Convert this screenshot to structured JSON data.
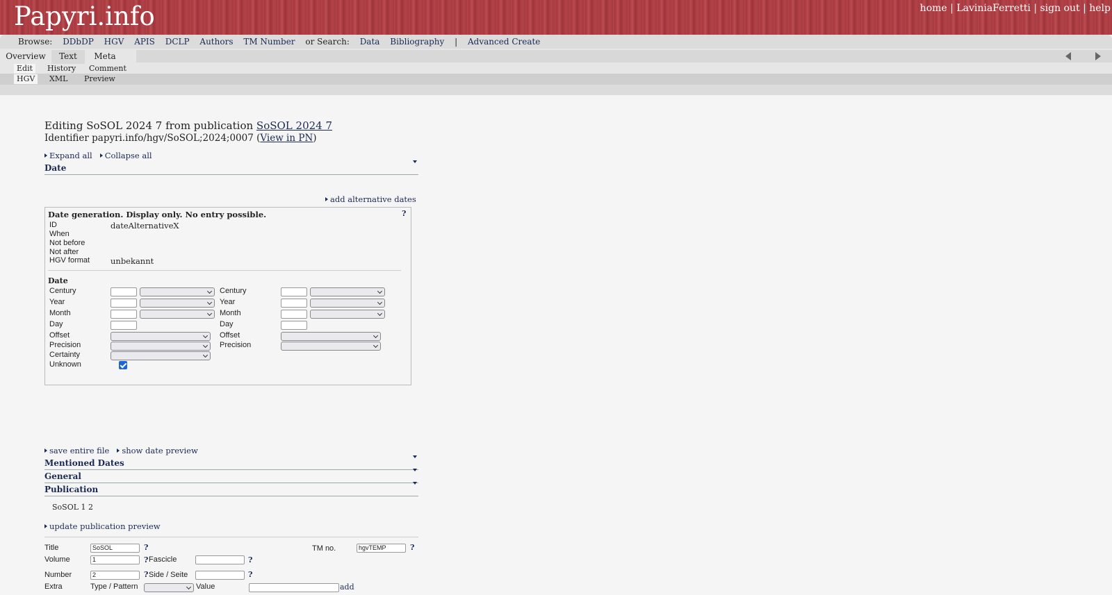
{
  "header": {
    "logo": "Papyri.info",
    "links": {
      "home": "home",
      "sep1": "|",
      "user": "LaviniaFerretti",
      "sep2": "|",
      "signout": "sign out",
      "sep3": "|",
      "help": "help"
    }
  },
  "browse": {
    "label": "Browse:",
    "items": [
      "DDbDP",
      "HGV",
      "APIS",
      "DCLP",
      "Authors",
      "TM Number"
    ],
    "search_label": "or Search:",
    "search_items": [
      "Data",
      "Bibliography"
    ],
    "divider": "|",
    "advanced": "Advanced Create"
  },
  "tabs": {
    "overview": "Overview",
    "text": "Text",
    "meta": "Meta"
  },
  "subtabs1": {
    "edit": "Edit",
    "history": "History",
    "comment": "Comment"
  },
  "subtabs2": {
    "hgv": "HGV",
    "xml": "XML",
    "preview": "Preview"
  },
  "page": {
    "title_prefix": "Editing SoSOL 2024 7 from publication",
    "title_link": "SoSOL 2024 7",
    "identifier_prefix": "Identifier papyri.info/hgv/SoSOL;2024;0007 (",
    "identifier_link": "View in PN",
    "identifier_suffix": ")",
    "expand_all": "Expand all",
    "collapse_all": "Collapse all"
  },
  "sections": {
    "date": "Date",
    "add_alt_dates": "add alternative dates",
    "save_file": "save entire file",
    "show_preview": "show date preview",
    "mentioned_dates": "Mentioned Dates",
    "general": "General",
    "publication": "Publication",
    "pub_preview_text": "SoSOL 1 2",
    "update_pub_preview": "update publication preview"
  },
  "datebox": {
    "title": "Date generation. Display only. No entry possible.",
    "help": "?",
    "fields": {
      "id_label": "ID",
      "id_value": "dateAlternativeX",
      "when_label": "When",
      "not_before_label": "Not before",
      "not_after_label": "Not after",
      "hgv_format_label": "HGV format",
      "hgv_format_value": "unbekannt"
    },
    "date_heading": "Date",
    "left": {
      "century": "Century",
      "year": "Year",
      "month": "Month",
      "day": "Day",
      "offset": "Offset",
      "precision": "Precision",
      "certainty": "Certainty",
      "unknown": "Unknown"
    },
    "right": {
      "century": "Century",
      "year": "Year",
      "month": "Month",
      "day": "Day",
      "offset": "Offset",
      "precision": "Precision"
    },
    "unknown_checked": true
  },
  "publication": {
    "title_label": "Title",
    "title_value": "SoSOL",
    "tm_label": "TM no.",
    "tm_value": "hgvTEMP",
    "volume_label": "Volume",
    "volume_value": "1",
    "fascicle_label": "Fascicle",
    "fascicle_value": "",
    "number_label": "Number",
    "number_value": "2",
    "side_label": "Side / Seite",
    "side_value": "",
    "extra_label": "Extra",
    "type_label": "Type / Pattern",
    "value_label": "Value",
    "add_label": "add",
    "help": "?"
  },
  "nav_icons": [
    "prev-arrow-icon",
    "next-arrow-icon",
    "triangle-right-icon",
    "chevron-down-icon",
    "checkbox-icon"
  ]
}
